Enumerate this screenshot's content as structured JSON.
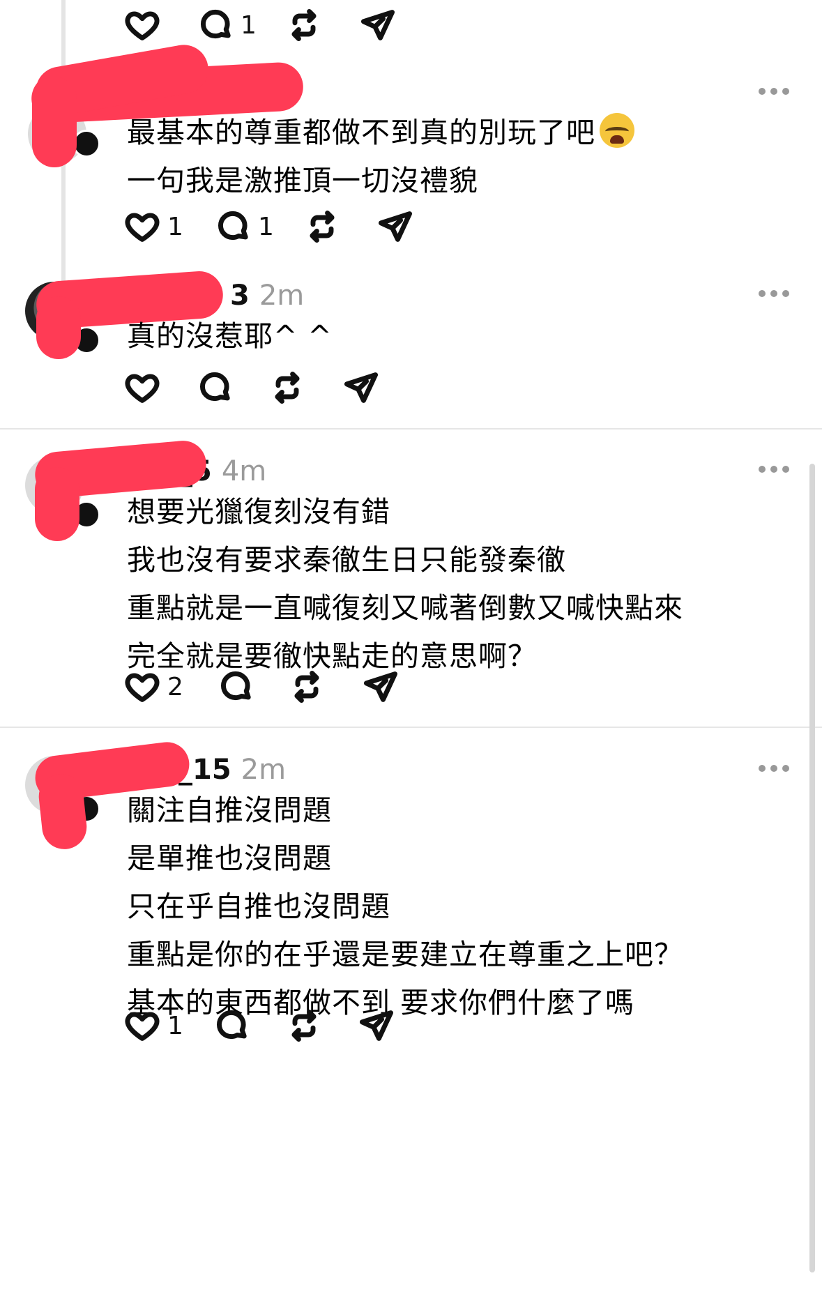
{
  "reply_top": {
    "actions": {
      "like_count": "",
      "reply_count": "1"
    }
  },
  "comments": [
    {
      "username": "",
      "time": "",
      "lines": [
        "最基本的尊重都做不到真的別玩了吧",
        "一句我是激推頂一切沒禮貌"
      ],
      "emoji": "loudly-crying-face-emoji",
      "actions": {
        "like_count": "1",
        "reply_count": "1"
      }
    },
    {
      "username": "3",
      "time": "2m",
      "lines": [
        "真的沒惹耶^ ^"
      ],
      "actions": {
        "like_count": "",
        "reply_count": ""
      }
    },
    {
      "username": "_5",
      "time": "4m",
      "lines": [
        "想要光獵復刻沒有錯",
        "我也沒有要求秦徹生日只能發秦徹",
        "重點就是一直喊復刻又喊著倒數又喊快點來",
        "完全就是要徹快點走的意思啊？"
      ],
      "actions": {
        "like_count": "2",
        "reply_count": ""
      }
    },
    {
      "username": "_15",
      "time": "2m",
      "lines": [
        "關注自推沒問題",
        "是單推也沒問題",
        "只在乎自推也沒問題",
        "重點是你的在乎還是要建立在尊重之上吧？",
        "基本的東西都做不到 要求你們什麼了嗎"
      ],
      "actions": {
        "like_count": "1",
        "reply_count": ""
      }
    }
  ],
  "icons": {
    "like": "heart-icon",
    "reply": "comment-bubble-icon",
    "repost": "repost-arrows-icon",
    "share": "paper-plane-send-icon",
    "more": "more-dots-icon"
  },
  "colors": {
    "redaction": "#ff3b55",
    "secondary_text": "#9a9a9a",
    "divider": "#e6e6e6"
  }
}
